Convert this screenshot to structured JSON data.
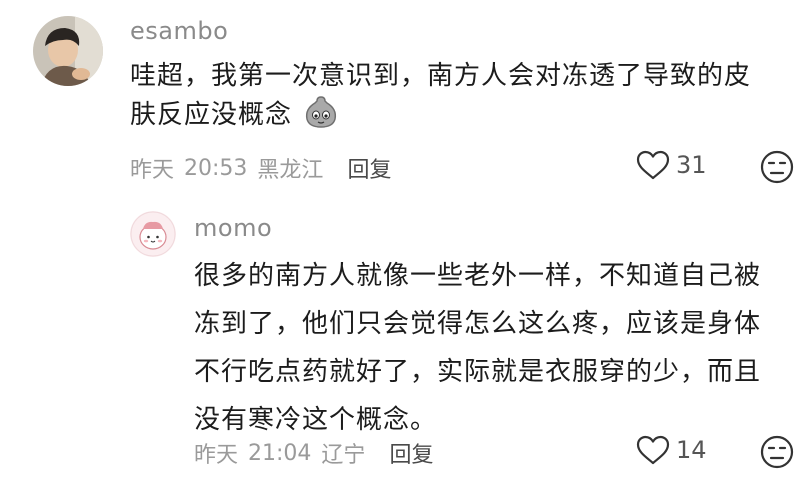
{
  "comments": [
    {
      "username": "esambo",
      "text_line1": "哇超，我第一次意识到，南方人会对冻透了导致的皮",
      "text_line2": "肤反应没概念",
      "emoji": "dust-bag-emoji",
      "date": "昨天",
      "time": "20:53",
      "location": "黑龙江",
      "reply_label": "回复",
      "likes": "31"
    },
    {
      "username": "momo",
      "lines": [
        "很多的南方人就像一些老外一样，不知道自己被",
        "冻到了，他们只会觉得怎么这么疼，应该是身体",
        "不行吃点药就好了，实际就是衣服穿的少，而且",
        "没有寒冷这个概念。"
      ],
      "date": "昨天",
      "time": "21:04",
      "location": "辽宁",
      "reply_label": "回复",
      "likes": "14"
    }
  ],
  "colors": {
    "username": "#8a8a8a",
    "text": "#1c1c1c",
    "meta": "#9a9a9a"
  },
  "icons": [
    "heart-outline-icon",
    "unamused-face-icon"
  ]
}
